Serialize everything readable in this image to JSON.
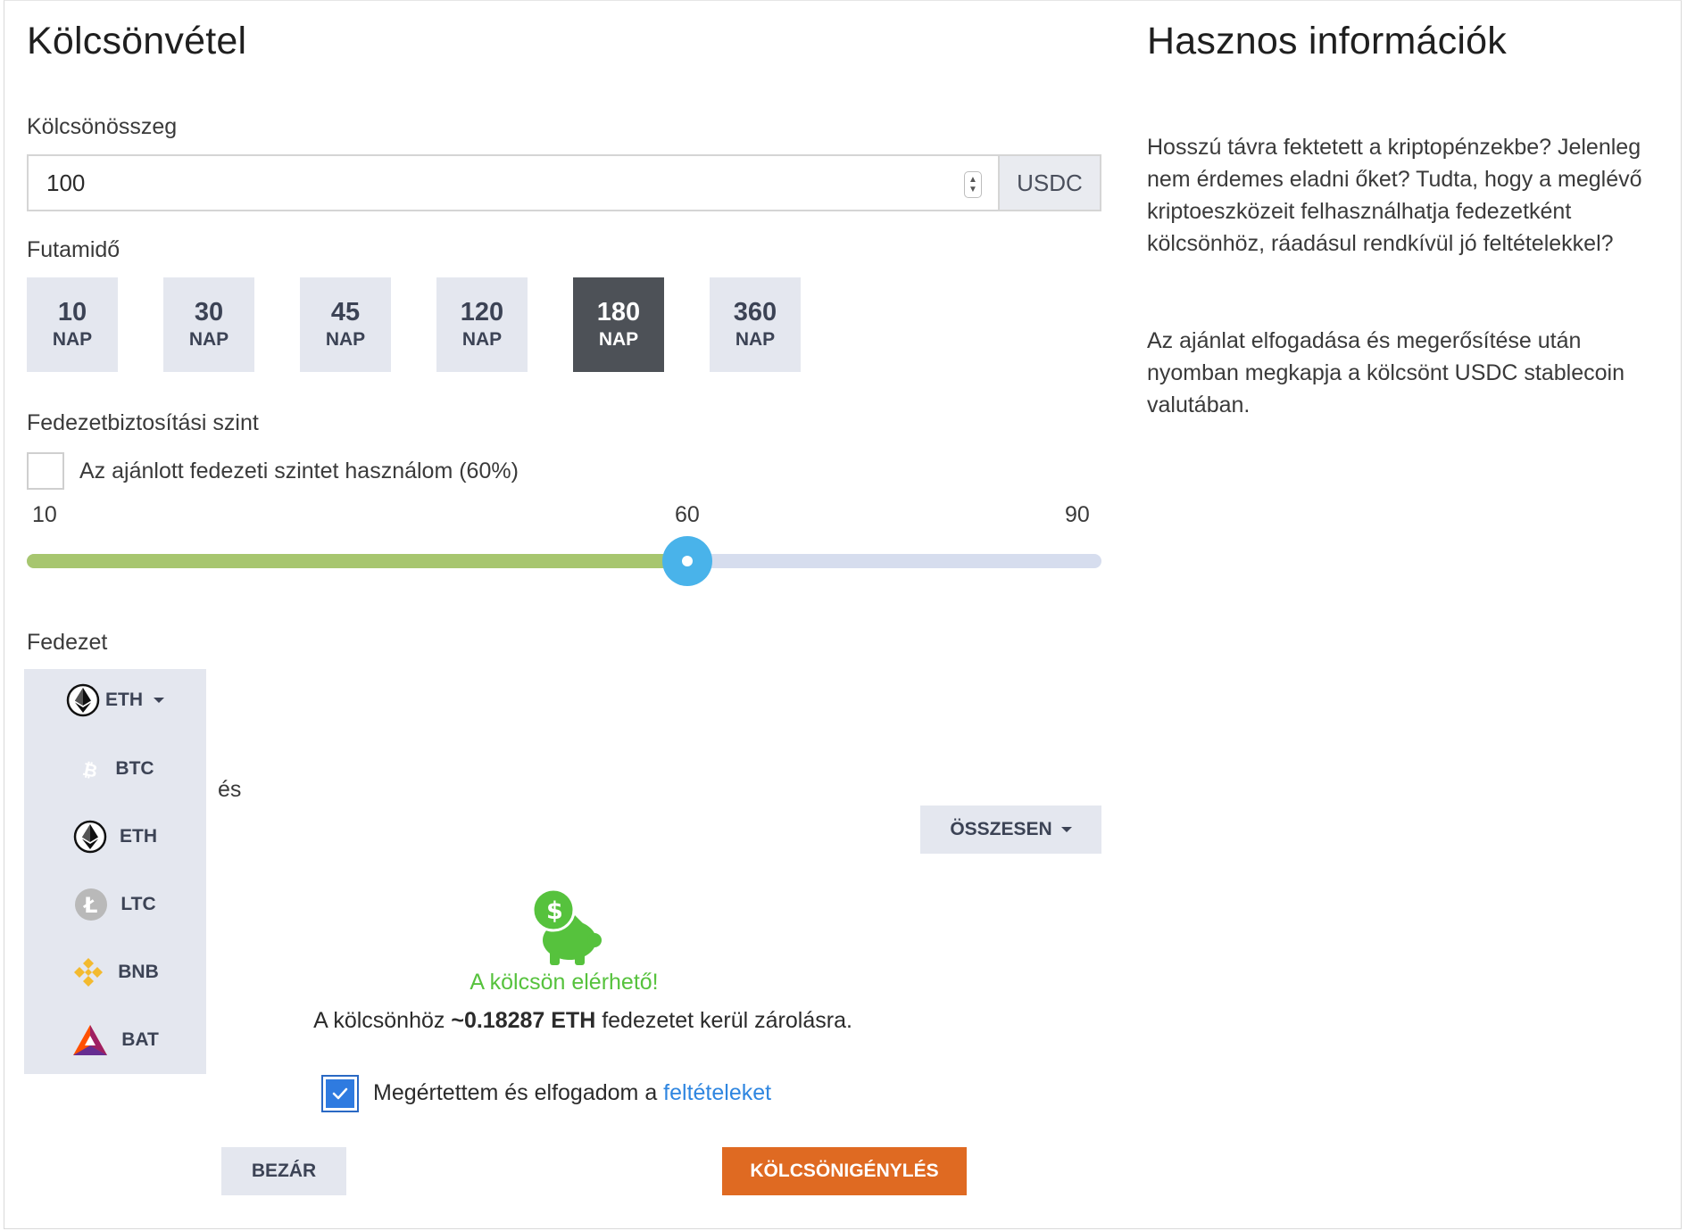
{
  "loan": {
    "title": "Kölcsönvétel",
    "amount_label": "Kölcsönösszeg",
    "amount_value": "100",
    "amount_unit": "USDC",
    "term_label": "Futamidő",
    "terms": [
      {
        "value": "10",
        "unit": "NAP",
        "active": false
      },
      {
        "value": "30",
        "unit": "NAP",
        "active": false
      },
      {
        "value": "45",
        "unit": "NAP",
        "active": false
      },
      {
        "value": "120",
        "unit": "NAP",
        "active": false
      },
      {
        "value": "180",
        "unit": "NAP",
        "active": true
      },
      {
        "value": "360",
        "unit": "NAP",
        "active": false
      }
    ],
    "ltv_label": "Fedezetbiztosítási szint",
    "ltv_checkbox_label": "Az ajánlott fedezeti szintet használom (60%)",
    "slider": {
      "min": "10",
      "value": "60",
      "max": "90",
      "fraction": 0.615
    },
    "collateral_label": "Fedezet",
    "collateral_selected": "ETH",
    "collateral_options": [
      "BTC",
      "ETH",
      "LTC",
      "BNB",
      "BAT"
    ],
    "hidden_text_fragment": "és",
    "total_button": "ÖSSZESEN",
    "available_text": "A kölcsön elérhető!",
    "summary_prefix": "A kölcsönhöz ",
    "summary_amount": "~0.18287 ETH",
    "summary_suffix": " fedezetet kerül zárolásra.",
    "terms_checkbox_text": "Megértettem és elfogadom a ",
    "terms_link": "feltételeket",
    "close_button": "BEZÁR",
    "submit_button": "KÖLCSÖNIGÉNYLÉS"
  },
  "info": {
    "title": "Hasznos információk",
    "paragraph1": "Hosszú távra fektetett a kriptopénzekbe? Jelenleg nem érdemes eladni őket? Tudta, hogy a meglévő kriptoeszközeit felhasználhatja fedezetként kölcsönhöz, ráadásul rendkívül jó feltételekkel?",
    "paragraph2": "Az ajánlat elfogadása és megerősítése után nyomban megkapja a kölcsönt USDC stablecoin valutában."
  },
  "colors": {
    "accent_blue": "#2f7be0",
    "slider_fill": "#a7c66f",
    "slider_thumb": "#49b3ea",
    "success_green": "#56c23d",
    "submit_orange": "#df6a22",
    "active_term": "#4d5157"
  }
}
